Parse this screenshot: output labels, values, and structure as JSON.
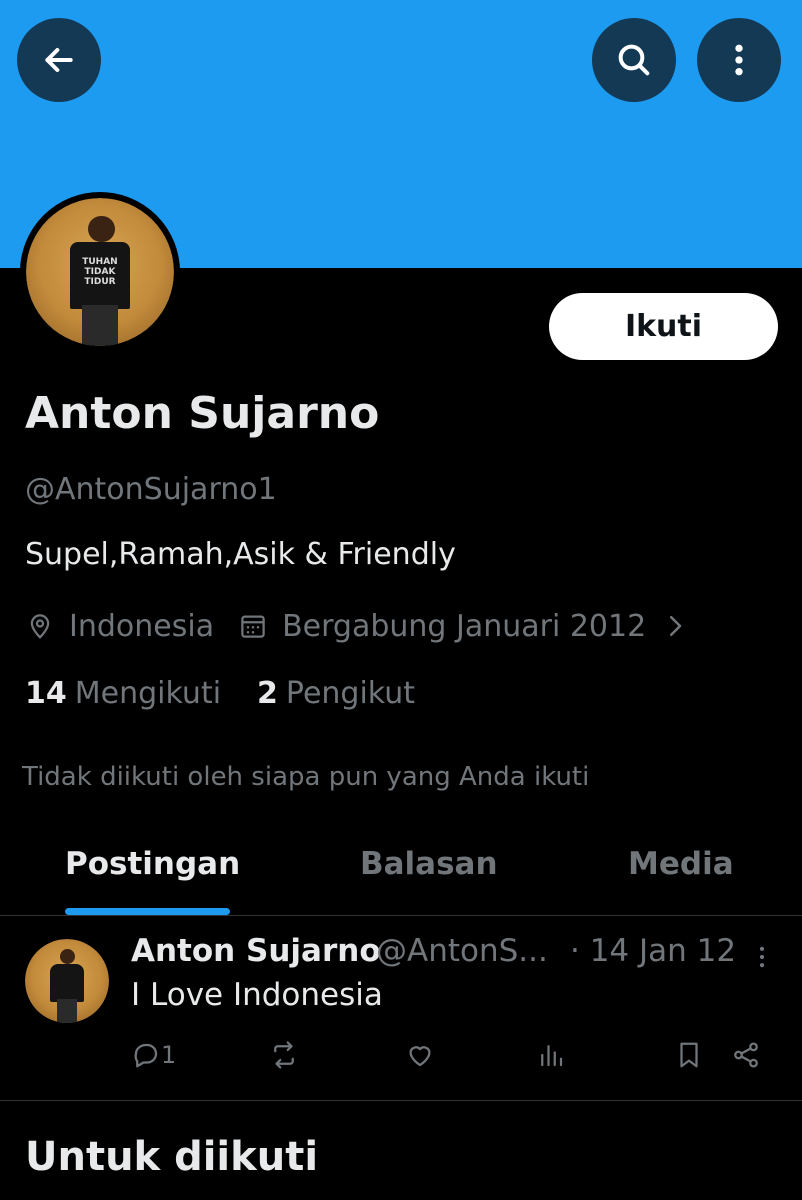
{
  "header": {
    "back_icon": "arrow-left-icon",
    "search_icon": "search-icon",
    "more_icon": "more-vertical-icon",
    "banner_color": "#1d9bf0"
  },
  "profile": {
    "avatar_shirt_text": "TUHAN TIDAK TIDUR",
    "follow_label": "Ikuti",
    "name": "Anton Sujarno",
    "handle": "@AntonSujarno1",
    "bio": "Supel,Ramah,Asik & Friendly",
    "location": "Indonesia",
    "joined": "Bergabung Januari 2012",
    "following_count": "14",
    "following_label": "Mengikuti",
    "followers_count": "2",
    "followers_label": "Pengikut",
    "not_followed_note": "Tidak diikuti oleh siapa pun yang Anda ikuti"
  },
  "tabs": [
    {
      "label": "Postingan",
      "active": true
    },
    {
      "label": "Balasan",
      "active": false
    },
    {
      "label": "Media",
      "active": false
    }
  ],
  "post": {
    "author": "Anton Sujarno",
    "handle": "@AntonS...",
    "date": "· 14 Jan 12",
    "text": "I Love Indonesia",
    "reply_count": "1"
  },
  "section": {
    "title": "Untuk diikuti"
  },
  "colors": {
    "accent": "#1d9bf0",
    "background": "#000000",
    "text_primary": "#e7e9ea",
    "text_secondary": "#71767b"
  }
}
